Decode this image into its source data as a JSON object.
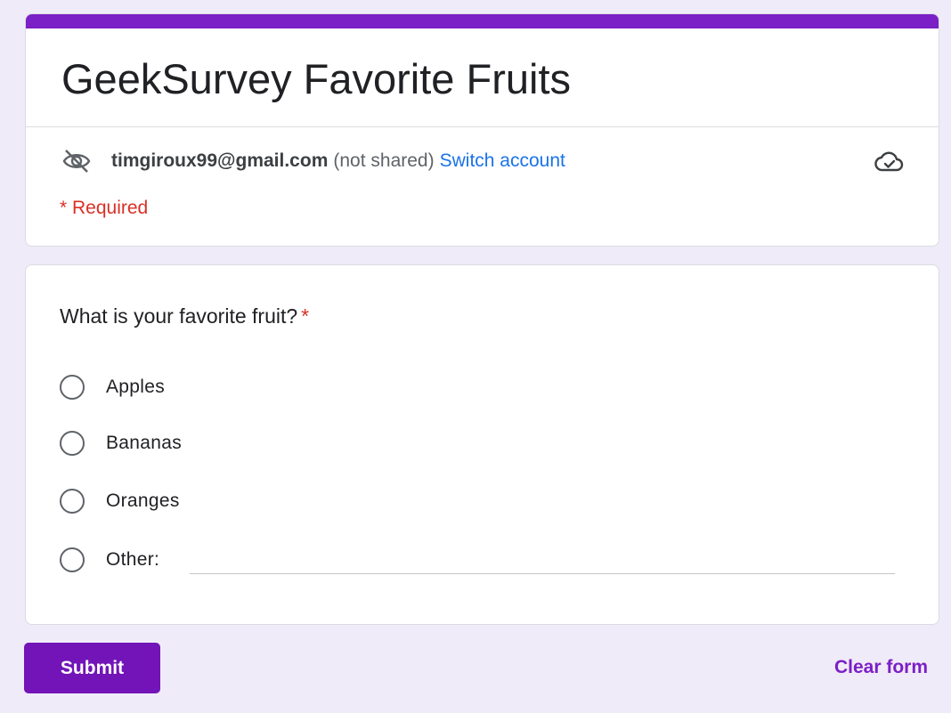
{
  "form": {
    "title": "GeekSurvey Favorite Fruits",
    "accent_color": "#7b1fc6"
  },
  "account": {
    "icon": "eye-off-icon",
    "email": "timgiroux99@gmail.com",
    "not_shared": "(not shared)",
    "switch_label": "Switch account",
    "cloud_icon": "cloud-check-icon"
  },
  "required_note": "* Required",
  "question": {
    "text": "What is your favorite fruit?",
    "required_mark": "*",
    "options": [
      {
        "label": "Apples"
      },
      {
        "label": "Bananas"
      },
      {
        "label": "Oranges"
      },
      {
        "label": "Other:"
      }
    ],
    "other_value": ""
  },
  "actions": {
    "submit_label": "Submit",
    "clear_label": "Clear form",
    "submit_color": "#7214b8"
  }
}
